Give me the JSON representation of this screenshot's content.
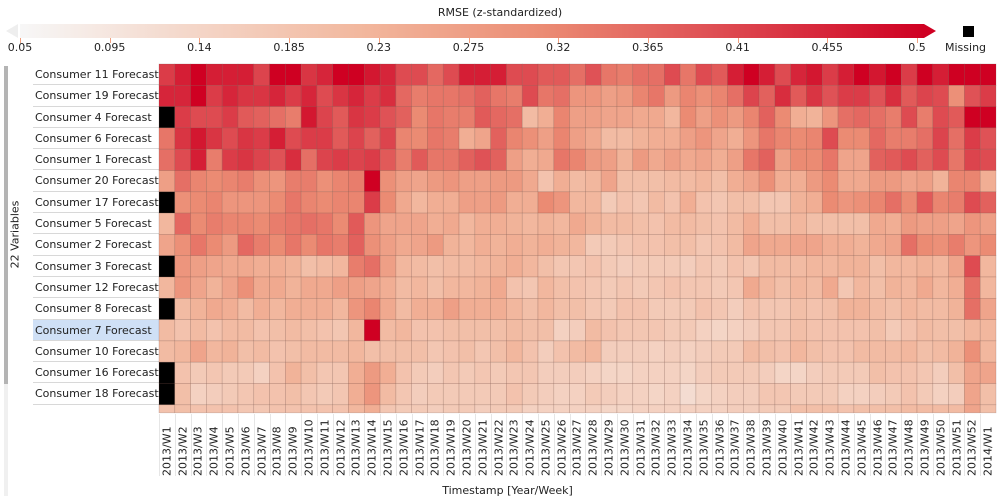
{
  "chart_data": {
    "type": "heatmap",
    "title": "",
    "legend": {
      "title": "RMSE (z-standardized)",
      "min": 0.05,
      "max": 0.5,
      "ticks": [
        "0.05",
        "0.095",
        "0.14",
        "0.185",
        "0.23",
        "0.275",
        "0.32",
        "0.365",
        "0.41",
        "0.455",
        "0.5"
      ],
      "missing_label": "Missing",
      "colors": [
        "#f7f7f7",
        "#f4d8cb",
        "#f2b79d",
        "#eb8b73",
        "#df5155",
        "#cf0022"
      ],
      "missing_color": "#000000",
      "placement": "top"
    },
    "ylabel": "22 Variables",
    "xlabel": "Timestamp [Year/Week]",
    "x": [
      "2013/W1",
      "2013/W2",
      "2013/W3",
      "2013/W4",
      "2013/W5",
      "2013/W6",
      "2013/W7",
      "2013/W8",
      "2013/W9",
      "2013/W10",
      "2013/W11",
      "2013/W12",
      "2013/W13",
      "2013/W14",
      "2013/W15",
      "2013/W16",
      "2013/W17",
      "2013/W18",
      "2013/W19",
      "2013/W20",
      "2013/W21",
      "2013/W22",
      "2013/W23",
      "2013/W24",
      "2013/W25",
      "2013/W26",
      "2013/W27",
      "2013/W28",
      "2013/W29",
      "2013/W30",
      "2013/W31",
      "2013/W32",
      "2013/W33",
      "2013/W34",
      "2013/W35",
      "2013/W36",
      "2013/W37",
      "2013/W38",
      "2013/W39",
      "2013/W40",
      "2013/W41",
      "2013/W42",
      "2013/W43",
      "2013/W44",
      "2013/W45",
      "2013/W46",
      "2013/W47",
      "2013/W48",
      "2013/W49",
      "2013/W50",
      "2013/W51",
      "2013/W52",
      "2014/W1"
    ],
    "y": [
      "Consumer 11 Forecast",
      "Consumer 19 Forecast",
      "Consumer 4 Forecast",
      "Consumer 6 Forecast",
      "Consumer 1 Forecast",
      "Consumer 20 Forecast",
      "Consumer 17 Forecast",
      "Consumer 5 Forecast",
      "Consumer 2 Forecast",
      "Consumer 3 Forecast",
      "Consumer 12 Forecast",
      "Consumer 8 Forecast",
      "Consumer 7 Forecast",
      "Consumer 10 Forecast",
      "Consumer 16 Forecast",
      "Consumer 18 Forecast"
    ],
    "selected_row": "Consumer 7 Forecast",
    "values": [
      [
        0.42,
        0.46,
        0.5,
        0.46,
        0.46,
        0.46,
        0.41,
        0.5,
        0.5,
        0.43,
        0.45,
        0.5,
        0.5,
        0.47,
        0.45,
        0.4,
        0.4,
        0.36,
        0.4,
        0.46,
        0.46,
        0.46,
        0.4,
        0.4,
        0.38,
        0.38,
        0.35,
        0.39,
        0.34,
        0.33,
        0.35,
        0.35,
        0.4,
        0.34,
        0.4,
        0.38,
        0.46,
        0.5,
        0.46,
        0.4,
        0.45,
        0.47,
        0.42,
        0.46,
        0.5,
        0.47,
        0.5,
        0.42,
        0.5,
        0.46,
        0.5,
        0.5,
        0.5
      ],
      [
        0.45,
        0.45,
        0.5,
        0.42,
        0.45,
        0.43,
        0.43,
        0.45,
        0.42,
        0.45,
        0.4,
        0.43,
        0.45,
        0.42,
        0.44,
        0.36,
        0.33,
        0.34,
        0.34,
        0.35,
        0.37,
        0.34,
        0.33,
        0.4,
        0.34,
        0.35,
        0.29,
        0.29,
        0.27,
        0.28,
        0.32,
        0.34,
        0.28,
        0.32,
        0.3,
        0.32,
        0.35,
        0.41,
        0.37,
        0.44,
        0.38,
        0.43,
        0.39,
        0.42,
        0.42,
        0.39,
        0.44,
        0.38,
        0.41,
        0.4,
        0.3,
        0.39,
        0.42
      ],
      [
        null,
        0.42,
        0.4,
        0.4,
        0.42,
        0.38,
        0.37,
        0.35,
        0.33,
        0.47,
        0.41,
        0.38,
        0.43,
        0.42,
        0.39,
        0.37,
        0.31,
        0.34,
        0.33,
        0.33,
        0.38,
        0.36,
        0.35,
        0.21,
        0.24,
        0.32,
        0.27,
        0.27,
        0.26,
        0.26,
        0.25,
        0.25,
        0.22,
        0.31,
        0.27,
        0.3,
        0.28,
        0.32,
        0.37,
        0.31,
        0.24,
        0.23,
        0.29,
        0.35,
        0.36,
        0.35,
        0.33,
        0.4,
        0.33,
        0.4,
        0.38,
        0.5,
        0.5
      ],
      [
        0.34,
        0.43,
        0.47,
        0.43,
        0.4,
        0.43,
        0.42,
        0.46,
        0.4,
        0.42,
        0.42,
        0.38,
        0.41,
        0.37,
        0.41,
        0.32,
        0.31,
        0.34,
        0.33,
        0.24,
        0.26,
        0.37,
        0.32,
        0.3,
        0.27,
        0.32,
        0.27,
        0.25,
        0.21,
        0.21,
        0.23,
        0.24,
        0.24,
        0.27,
        0.29,
        0.26,
        0.24,
        0.29,
        0.34,
        0.32,
        0.31,
        0.32,
        0.4,
        0.31,
        0.31,
        0.36,
        0.33,
        0.33,
        0.35,
        0.41,
        0.35,
        0.42,
        0.39
      ],
      [
        0.35,
        0.4,
        0.46,
        0.33,
        0.42,
        0.43,
        0.41,
        0.39,
        0.44,
        0.35,
        0.41,
        0.42,
        0.41,
        0.42,
        0.38,
        0.33,
        0.38,
        0.34,
        0.34,
        0.37,
        0.39,
        0.37,
        0.27,
        0.24,
        0.25,
        0.34,
        0.32,
        0.28,
        0.27,
        0.23,
        0.28,
        0.25,
        0.27,
        0.25,
        0.26,
        0.24,
        0.27,
        0.34,
        0.37,
        0.27,
        0.31,
        0.31,
        0.34,
        0.26,
        0.26,
        0.37,
        0.38,
        0.4,
        0.37,
        0.4,
        0.34,
        0.41,
        0.4
      ],
      [
        0.27,
        0.35,
        0.32,
        0.31,
        0.32,
        0.33,
        0.3,
        0.29,
        0.33,
        0.33,
        0.3,
        0.32,
        0.33,
        0.5,
        0.3,
        0.27,
        0.26,
        0.28,
        0.29,
        0.27,
        0.27,
        0.28,
        0.28,
        0.25,
        0.19,
        0.24,
        0.21,
        0.22,
        0.26,
        0.2,
        0.2,
        0.2,
        0.21,
        0.21,
        0.22,
        0.2,
        0.24,
        0.26,
        0.3,
        0.24,
        0.24,
        0.28,
        0.31,
        0.25,
        0.25,
        0.28,
        0.28,
        0.26,
        0.27,
        0.23,
        0.32,
        0.32,
        0.24
      ],
      [
        null,
        0.3,
        0.31,
        0.32,
        0.29,
        0.29,
        0.29,
        0.31,
        0.34,
        0.32,
        0.31,
        0.32,
        0.32,
        0.42,
        0.31,
        0.25,
        0.22,
        0.24,
        0.24,
        0.27,
        0.27,
        0.28,
        0.24,
        0.24,
        0.31,
        0.29,
        0.22,
        0.22,
        0.17,
        0.19,
        0.18,
        0.21,
        0.19,
        0.24,
        0.19,
        0.18,
        0.2,
        0.2,
        0.18,
        0.18,
        0.23,
        0.24,
        0.31,
        0.29,
        0.3,
        0.32,
        0.35,
        0.31,
        0.38,
        0.32,
        0.33,
        0.4,
        0.37
      ],
      [
        0.22,
        0.36,
        0.31,
        0.33,
        0.32,
        0.32,
        0.31,
        0.33,
        0.34,
        0.35,
        0.34,
        0.31,
        0.38,
        0.29,
        0.26,
        0.26,
        0.26,
        0.24,
        0.25,
        0.22,
        0.24,
        0.24,
        0.23,
        0.22,
        0.23,
        0.22,
        0.25,
        0.23,
        0.21,
        0.21,
        0.2,
        0.19,
        0.21,
        0.21,
        0.2,
        0.19,
        0.21,
        0.24,
        0.2,
        0.2,
        0.22,
        0.2,
        0.2,
        0.2,
        0.2,
        0.25,
        0.24,
        0.28,
        0.27,
        0.27,
        0.26,
        0.29,
        0.27
      ],
      [
        0.26,
        0.3,
        0.34,
        0.31,
        0.28,
        0.36,
        0.33,
        0.31,
        0.34,
        0.31,
        0.34,
        0.33,
        0.37,
        0.3,
        0.27,
        0.25,
        0.26,
        0.28,
        0.23,
        0.22,
        0.24,
        0.23,
        0.24,
        0.23,
        0.24,
        0.23,
        0.22,
        0.17,
        0.17,
        0.18,
        0.19,
        0.19,
        0.2,
        0.2,
        0.18,
        0.19,
        0.21,
        0.26,
        0.25,
        0.25,
        0.26,
        0.26,
        0.24,
        0.24,
        0.23,
        0.25,
        0.26,
        0.35,
        0.31,
        0.3,
        0.33,
        0.29,
        0.31
      ],
      [
        null,
        0.29,
        0.27,
        0.26,
        0.25,
        0.25,
        0.24,
        0.24,
        0.23,
        0.2,
        0.21,
        0.22,
        0.33,
        0.35,
        0.27,
        0.22,
        0.21,
        0.2,
        0.21,
        0.21,
        0.22,
        0.23,
        0.24,
        0.22,
        0.2,
        0.18,
        0.18,
        0.19,
        0.17,
        0.16,
        0.17,
        0.17,
        0.17,
        0.16,
        0.18,
        0.17,
        0.19,
        0.18,
        0.21,
        0.21,
        0.21,
        0.22,
        0.22,
        0.23,
        0.23,
        0.2,
        0.22,
        0.22,
        0.23,
        0.22,
        0.26,
        0.4,
        0.22
      ],
      [
        0.22,
        0.29,
        0.26,
        0.23,
        0.26,
        0.3,
        0.25,
        0.25,
        0.23,
        0.25,
        0.25,
        0.27,
        0.27,
        0.26,
        0.24,
        0.21,
        0.22,
        0.2,
        0.22,
        0.22,
        0.23,
        0.25,
        0.19,
        0.18,
        0.22,
        0.2,
        0.19,
        0.18,
        0.17,
        0.18,
        0.17,
        0.18,
        0.19,
        0.18,
        0.18,
        0.17,
        0.18,
        0.25,
        0.22,
        0.2,
        0.22,
        0.21,
        0.25,
        0.18,
        0.22,
        0.2,
        0.23,
        0.22,
        0.25,
        0.22,
        0.24,
        0.35,
        0.22
      ],
      [
        null,
        0.21,
        0.23,
        0.25,
        0.24,
        0.21,
        0.24,
        0.22,
        0.24,
        0.24,
        0.24,
        0.22,
        0.29,
        0.32,
        0.25,
        0.21,
        0.24,
        0.24,
        0.27,
        0.24,
        0.24,
        0.24,
        0.22,
        0.2,
        0.22,
        0.2,
        0.2,
        0.18,
        0.17,
        0.19,
        0.19,
        0.17,
        0.17,
        0.17,
        0.19,
        0.18,
        0.16,
        0.19,
        0.18,
        0.18,
        0.2,
        0.19,
        0.2,
        0.23,
        0.23,
        0.21,
        0.2,
        0.22,
        0.21,
        0.21,
        0.23,
        0.35,
        0.26
      ],
      [
        0.21,
        0.19,
        0.21,
        0.19,
        0.21,
        0.21,
        0.19,
        0.2,
        0.21,
        0.2,
        0.19,
        0.18,
        0.22,
        0.5,
        0.21,
        0.22,
        0.19,
        0.19,
        0.2,
        0.2,
        0.2,
        0.2,
        0.21,
        0.2,
        0.2,
        0.15,
        0.16,
        0.21,
        0.19,
        0.18,
        0.18,
        0.18,
        0.17,
        0.17,
        0.15,
        0.14,
        0.15,
        0.16,
        0.18,
        0.18,
        0.2,
        0.19,
        0.19,
        0.19,
        0.19,
        0.2,
        0.17,
        0.19,
        0.21,
        0.2,
        0.2,
        0.22,
        0.22
      ],
      [
        0.21,
        0.22,
        0.26,
        0.22,
        0.23,
        0.2,
        0.21,
        0.19,
        0.2,
        0.21,
        0.21,
        0.21,
        0.22,
        0.2,
        0.2,
        0.2,
        0.2,
        0.18,
        0.19,
        0.2,
        0.18,
        0.2,
        0.22,
        0.19,
        0.16,
        0.19,
        0.21,
        0.22,
        0.16,
        0.16,
        0.16,
        0.15,
        0.16,
        0.15,
        0.16,
        0.17,
        0.17,
        0.21,
        0.2,
        0.19,
        0.22,
        0.2,
        0.19,
        0.19,
        0.21,
        0.21,
        0.21,
        0.22,
        0.2,
        0.21,
        0.23,
        0.3,
        0.22
      ],
      [
        null,
        0.19,
        0.17,
        0.18,
        0.17,
        0.17,
        0.15,
        0.19,
        0.23,
        0.2,
        0.18,
        0.18,
        0.24,
        0.28,
        0.24,
        0.19,
        0.17,
        0.16,
        0.18,
        0.17,
        0.18,
        0.17,
        0.18,
        0.18,
        0.16,
        0.16,
        0.16,
        0.15,
        0.14,
        0.14,
        0.15,
        0.15,
        0.15,
        0.14,
        0.16,
        0.17,
        0.17,
        0.17,
        0.16,
        0.14,
        0.14,
        0.16,
        0.17,
        0.17,
        0.17,
        0.2,
        0.19,
        0.19,
        0.18,
        0.16,
        0.2,
        0.26,
        0.26
      ],
      [
        null,
        0.2,
        0.15,
        0.16,
        0.17,
        0.18,
        0.19,
        0.19,
        0.2,
        0.18,
        0.17,
        0.18,
        0.24,
        0.29,
        0.21,
        0.18,
        0.16,
        0.17,
        0.17,
        0.17,
        0.17,
        0.17,
        0.19,
        0.17,
        0.16,
        0.15,
        0.15,
        0.17,
        0.16,
        0.15,
        0.15,
        0.14,
        0.15,
        0.12,
        0.14,
        0.15,
        0.16,
        0.16,
        0.18,
        0.18,
        0.17,
        0.17,
        0.17,
        0.15,
        0.15,
        0.16,
        0.17,
        0.19,
        0.17,
        0.15,
        0.16,
        0.26,
        0.2
      ]
    ],
    "partial_row_values": [
      0.19,
      0.2,
      0.19,
      0.19,
      0.19,
      0.18,
      0.18,
      0.19,
      0.19,
      0.19,
      0.19,
      0.19,
      0.22,
      0.24,
      0.18,
      0.17,
      0.17,
      0.16,
      0.17,
      0.17,
      0.16,
      0.17,
      0.17,
      0.15,
      0.15,
      0.15,
      0.15,
      0.15,
      0.14,
      0.14,
      0.15,
      0.15,
      0.15,
      0.15,
      0.15,
      0.15,
      0.16,
      0.16,
      0.17,
      0.17,
      0.2,
      0.2,
      0.2,
      0.19,
      0.2,
      0.2,
      0.2,
      0.21,
      0.21,
      0.21,
      0.21,
      0.26,
      0.2
    ]
  }
}
